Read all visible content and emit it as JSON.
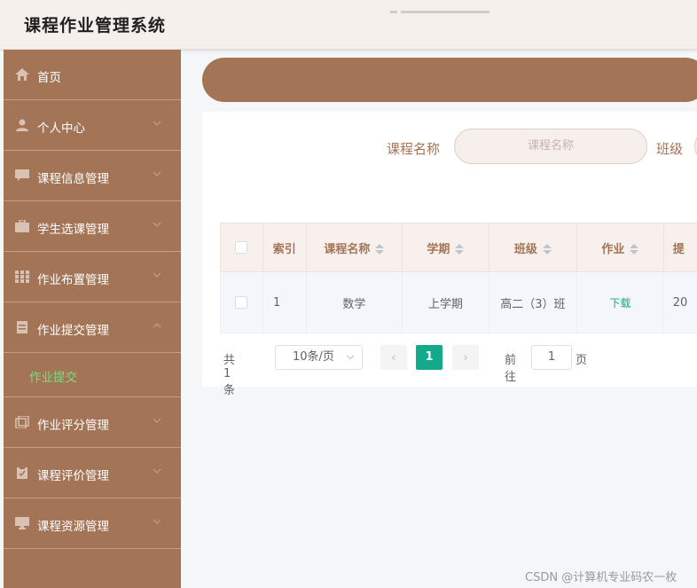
{
  "app": {
    "title": "课程作业管理系统"
  },
  "sidebar": {
    "items": [
      {
        "label": "首页",
        "icon": "home-icon",
        "expandable": false
      },
      {
        "label": "个人中心",
        "icon": "user-icon",
        "expandable": true
      },
      {
        "label": "课程信息管理",
        "icon": "chat-icon",
        "expandable": true
      },
      {
        "label": "学生选课管理",
        "icon": "briefcase-icon",
        "expandable": true
      },
      {
        "label": "作业布置管理",
        "icon": "grid-icon",
        "expandable": true
      },
      {
        "label": "作业提交管理",
        "icon": "document-icon",
        "expandable": true,
        "expanded": true,
        "children": [
          {
            "label": "作业提交",
            "active": true
          }
        ]
      },
      {
        "label": "作业评分管理",
        "icon": "copy-icon",
        "expandable": true
      },
      {
        "label": "课程评价管理",
        "icon": "clipboard-check-icon",
        "expandable": true
      },
      {
        "label": "课程资源管理",
        "icon": "monitor-icon",
        "expandable": true
      }
    ]
  },
  "search": {
    "course_label": "课程名称",
    "course_placeholder": "课程名称",
    "class_label": "班级"
  },
  "table": {
    "columns": [
      "索引",
      "课程名称",
      "学期",
      "班级",
      "作业",
      "提"
    ],
    "rows": [
      {
        "index": "1",
        "course": "数学",
        "term": "上学期",
        "class": "高二（3）班",
        "homework": "下载",
        "submitted": "20"
      }
    ]
  },
  "pagination": {
    "total_text": "共 1 条",
    "page_size": "10条/页",
    "prev": "‹",
    "current_page": "1",
    "next": "›",
    "goto_prefix": "前往",
    "goto_value": "1",
    "goto_suffix": "页"
  },
  "watermark": "CSDN @计算机专业码农一枚",
  "colors": {
    "brand": "#a47457",
    "accent": "#13a98a",
    "submenu_active": "#78e07a",
    "header_bg": "#f6f0ed"
  }
}
